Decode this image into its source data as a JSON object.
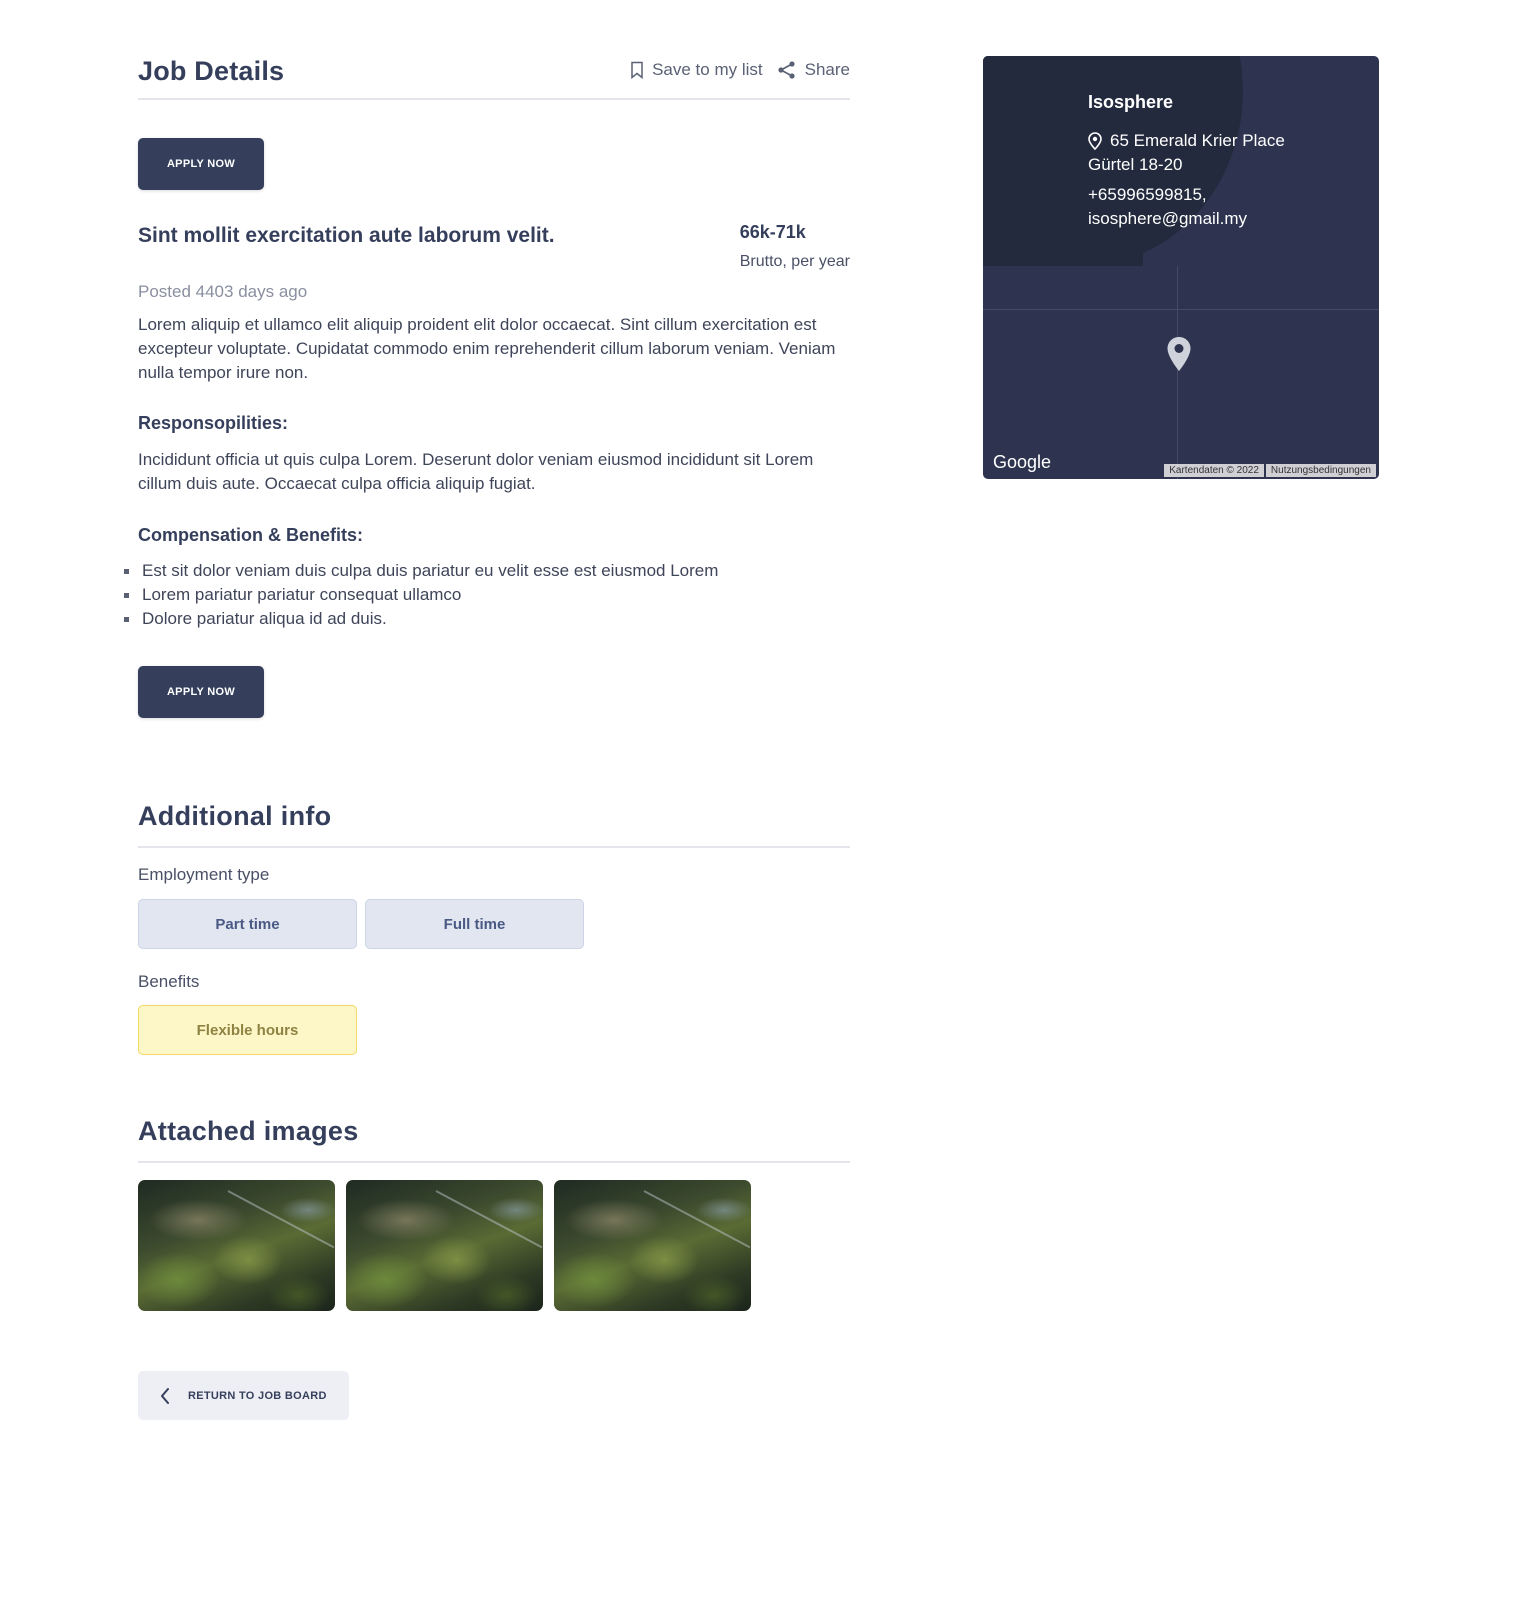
{
  "header": {
    "title": "Job Details",
    "save_label": "Save to my list",
    "share_label": "Share"
  },
  "apply_label": "APPLY NOW",
  "job": {
    "title": "Sint mollit exercitation aute laborum velit.",
    "salary": "66k-71k",
    "salary_note": "Brutto, per year",
    "posted": "Posted 4403 days ago",
    "description": "Lorem aliquip et ullamco elit aliquip proident elit dolor occaecat. Sint cillum exercitation est excepteur voluptate. Cupidatat commodo enim reprehenderit cillum laborum veniam. Veniam nulla tempor irure non.",
    "responsibilities_heading": "Responsopilities:",
    "responsibilities_text": "Incididunt officia ut quis culpa Lorem. Deserunt dolor veniam eiusmod incididunt sit Lorem cillum duis aute. Occaecat culpa officia aliquip fugiat.",
    "compensation_heading": "Compensation & Benefits:",
    "compensation_items": [
      "Est sit dolor veniam duis culpa duis pariatur eu velit esse est eiusmod Lorem",
      "Lorem pariatur pariatur consequat ullamco",
      "Dolore pariatur aliqua id ad duis."
    ]
  },
  "additional_info": {
    "title": "Additional info",
    "employment_label": "Employment type",
    "employment_types": [
      "Part time",
      "Full time"
    ],
    "benefits_label": "Benefits",
    "benefits": [
      "Flexible hours"
    ]
  },
  "images": {
    "title": "Attached images"
  },
  "return_label": "RETURN TO JOB BOARD",
  "company": {
    "name": "Isosphere",
    "address_line1": "65 Emerald Krier Place",
    "address_line2": "Gürtel 18-20",
    "phone": "+65996599815,",
    "email": "isosphere@gmail.my"
  },
  "map": {
    "brand": "Google",
    "data_label": "Kartendaten © 2022",
    "terms_label": "Nutzungsbedingungen"
  },
  "colors": {
    "primary": "#353f5c",
    "chip_blue_bg": "#e1e6f1",
    "chip_yellow_bg": "#fdf6c6",
    "map_bg": "#2e3450"
  }
}
